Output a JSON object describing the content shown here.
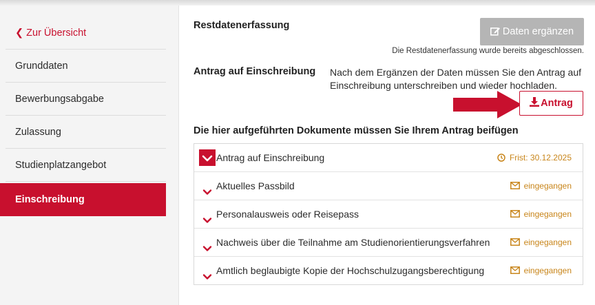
{
  "sidebar": {
    "items": [
      {
        "label": "Zur Übersicht"
      },
      {
        "label": "Grunddaten"
      },
      {
        "label": "Bewerbungsabgabe"
      },
      {
        "label": "Zulassung"
      },
      {
        "label": "Studienplatzangebot"
      },
      {
        "label": "Einschreibung",
        "active": true
      }
    ]
  },
  "restdaten": {
    "title": "Restdatenerfassung",
    "button_label": "Daten ergänzen",
    "note": "Die Restdatenerfassung wurde bereits abgeschlossen."
  },
  "antrag": {
    "title": "Antrag auf Einschreibung",
    "description": "Nach dem Ergänzen der Daten müssen Sie den Antrag auf Einschreibung unterschreiben und wieder hochladen.",
    "button_label": "Antrag"
  },
  "documents": {
    "heading": "Die hier aufgeführten Dokumente müssen Sie Ihrem Antrag beifügen",
    "rows": [
      {
        "label": "Antrag auf Einschreibung",
        "status": "Frist: 30.12.2025",
        "status_icon": "clock-icon"
      },
      {
        "label": "Aktuelles Passbild",
        "status": "eingegangen",
        "status_icon": "envelope-icon"
      },
      {
        "label": "Personalausweis oder Reisepass",
        "status": "eingegangen",
        "status_icon": "envelope-icon"
      },
      {
        "label": "Nachweis über die Teilnahme am Studienorientierungsverfahren",
        "status": "eingegangen",
        "status_icon": "envelope-icon"
      },
      {
        "label": "Amtlich beglaubigte Kopie der Hochschulzugangsberechtigung",
        "status": "eingegangen",
        "status_icon": "envelope-icon"
      }
    ]
  },
  "colors": {
    "accent": "#c8102e",
    "status_orange": "#c8851a",
    "button_disabled": "#b5b5b5"
  }
}
